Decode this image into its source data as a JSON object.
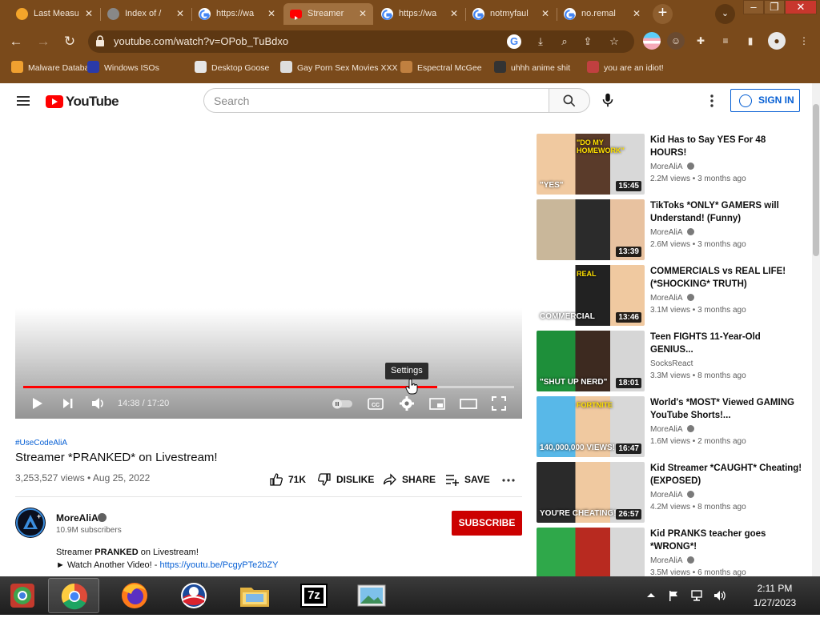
{
  "browser": {
    "tabs": [
      {
        "title": "Last Measu",
        "favicon_color": "#f4a52a",
        "favicon": "star-badge-icon"
      },
      {
        "title": "Index of /",
        "favicon_color": "#888888",
        "favicon": "globe-icon"
      },
      {
        "title": "https://wa",
        "favicon_color": "#ffffff",
        "favicon": "google-icon"
      },
      {
        "title": "Streamer",
        "favicon_color": "#ff0000",
        "favicon": "youtube-icon"
      },
      {
        "title": "https://wa",
        "favicon_color": "#ffffff",
        "favicon": "google-icon"
      },
      {
        "title": "notmyfaul",
        "favicon_color": "#ffffff",
        "favicon": "google-icon"
      },
      {
        "title": "no.remal",
        "favicon_color": "#ffffff",
        "favicon": "google-icon"
      }
    ],
    "active_tab_index": 3,
    "new_tab_label": "+",
    "tab_search_label": "⌄",
    "url": "youtube.com/watch?v=OPob_TuBdxo",
    "bookmarks": [
      {
        "label": "Malware Database",
        "color": "#f0a030"
      },
      {
        "label": "Windows ISOs",
        "color": "#2a3aa8"
      },
      {
        "label": "Desktop Goose",
        "color": "#e6e6e6"
      },
      {
        "label": "Gay Porn Sex Movies XXX",
        "color": "#dddddd"
      },
      {
        "label": "Espectral McGee",
        "color": "#c08040"
      },
      {
        "label": "uhhh anime shit",
        "color": "#333333"
      },
      {
        "label": "you are an idiot!",
        "color": "#c04040"
      }
    ]
  },
  "youtube": {
    "logo_text": "YouTube",
    "search_placeholder": "Search",
    "signin_label": "SIGN IN",
    "player": {
      "current_time": "14:38",
      "duration": "17:20",
      "time_display": "14:38 / 17:20",
      "progress_fraction": 0.844,
      "tooltip": "Settings"
    },
    "video": {
      "hashtag": "#UseCodeAliA",
      "title": "Streamer *PRANKED* on Livestream!",
      "meta": "3,253,527 views • Aug 25, 2022",
      "likes": "71K",
      "dislike_label": "DISLIKE",
      "share_label": "SHARE",
      "save_label": "SAVE"
    },
    "channel": {
      "name": "MoreAliA",
      "subscribers": "10.9M subscribers",
      "subscribe_label": "SUBSCRIBE"
    },
    "description": {
      "line1_pre": "Streamer ",
      "line1_bold": "PRANKED",
      "line1_post": " on Livestream!",
      "line2_pre": "► Watch Another Video! - ",
      "line2_link": "https://youtu.be/PcgyPTe2bZY"
    },
    "recommendations": [
      {
        "title": "Kid Has to Say YES For 48 HOURS!",
        "channel": "MoreAliA",
        "verified": true,
        "views": "2.2M views • 3 months ago",
        "duration": "15:45",
        "thumb_colors": [
          "#f0c9a0",
          "#5a3b2a",
          "#d8d8d8"
        ],
        "thumb_text": "\"YES\"",
        "thumb_text2": "\"DO MY HOMEWORK\""
      },
      {
        "title": "TikToks *ONLY* GAMERS will Understand! (Funny)",
        "channel": "MoreAliA",
        "verified": true,
        "views": "2.6M views • 3 months ago",
        "duration": "13:39",
        "thumb_colors": [
          "#c9b79a",
          "#2b2b2b",
          "#e8c2a0"
        ],
        "thumb_text": "",
        "thumb_text2": ""
      },
      {
        "title": "COMMERCIALS vs REAL LIFE! (*SHOCKING* TRUTH)",
        "channel": "MoreAliA",
        "verified": true,
        "views": "3.1M views • 3 months ago",
        "duration": "13:46",
        "thumb_colors": [
          "#ffffff",
          "#222222",
          "#f0c9a0"
        ],
        "thumb_text": "COMMERCIAL",
        "thumb_text2": "REAL"
      },
      {
        "title": "Teen FIGHTS 11-Year-Old GENIUS...",
        "channel": "SocksReact",
        "verified": false,
        "views": "3.3M views • 8 months ago",
        "duration": "18:01",
        "thumb_colors": [
          "#1e8f3a",
          "#3d2a20",
          "#d6d6d6"
        ],
        "thumb_text": "\"SHUT UP NERD\"",
        "thumb_text2": ""
      },
      {
        "title": "World's *MOST* Viewed GAMING YouTube Shorts!...",
        "channel": "MoreAliA",
        "verified": true,
        "views": "1.6M views • 2 months ago",
        "duration": "16:47",
        "thumb_colors": [
          "#58b8e8",
          "#f0c9a0",
          "#d8d8d8"
        ],
        "thumb_text": "140,000,000 VIEWS!",
        "thumb_text2": "FORTNITE"
      },
      {
        "title": "Kid Streamer *CAUGHT* Cheating! (EXPOSED)",
        "channel": "MoreAliA",
        "verified": true,
        "views": "4.2M views • 8 months ago",
        "duration": "26:57",
        "thumb_colors": [
          "#2a2a2a",
          "#f0c9a0",
          "#d8d8d8"
        ],
        "thumb_text": "YOU'RE CHEATING!",
        "thumb_text2": ""
      },
      {
        "title": "Kid PRANKS teacher goes *WRONG*!",
        "channel": "MoreAliA",
        "verified": true,
        "views": "3.5M views • 6 months ago",
        "duration": "",
        "thumb_colors": [
          "#2fa84a",
          "#b82a20",
          "#d8d8d8"
        ],
        "thumb_text": "",
        "thumb_text2": ""
      }
    ]
  },
  "taskbar": {
    "apps": [
      "chrome-alt-icon",
      "chrome-icon",
      "firefox-icon",
      "obama-logo-icon",
      "file-explorer-icon",
      "7zip-icon",
      "photo-viewer-icon"
    ],
    "seven_zip_label": "7z",
    "time": "2:11 PM",
    "date": "1/27/2023"
  }
}
